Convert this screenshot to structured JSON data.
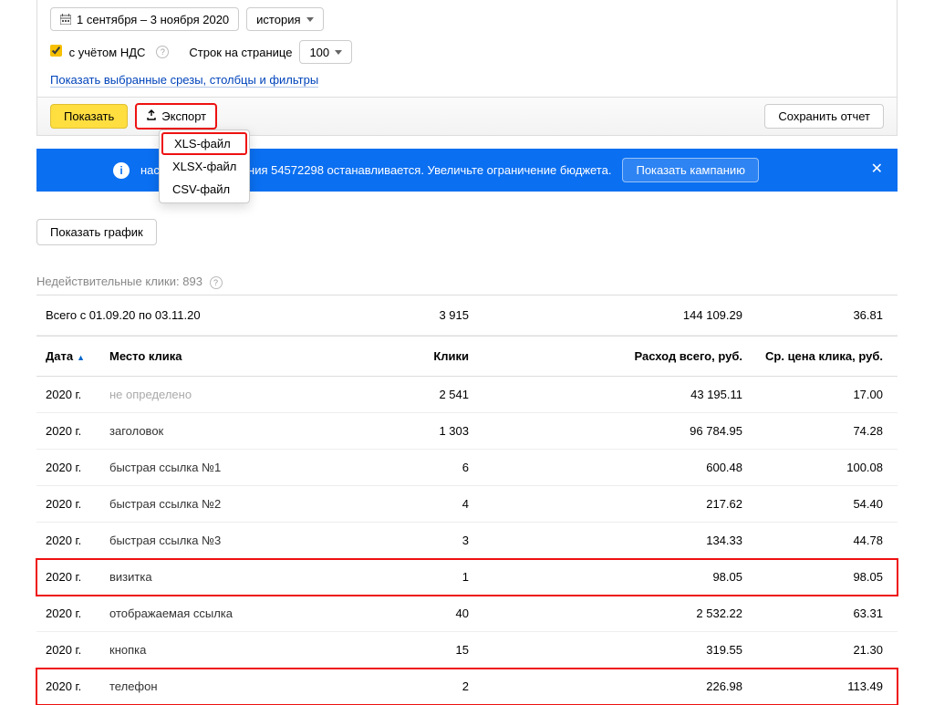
{
  "filters": {
    "date_range": "1 сентября – 3 ноября 2020",
    "history_label": "история",
    "nds_label": "с учётом НДС",
    "perpage_label": "Строк на странице",
    "perpage_value": "100",
    "filters_link": "Показать выбранные срезы, столбцы и фильтры"
  },
  "actions": {
    "show": "Показать",
    "export": "Экспорт",
    "save_report": "Сохранить отчет",
    "show_graph": "Показать график"
  },
  "export_menu": {
    "xls": "XLS-файл",
    "xlsx": "XLSX-файл",
    "csv": "CSV-файл"
  },
  "banner": {
    "text": "настройками кампания 54572298 останавливается. Увеличьте ограничение бюджета.",
    "action": "Показать кампанию"
  },
  "invalid_clicks": {
    "label": "Недействительные клики:",
    "value": "893"
  },
  "totals": {
    "label": "Всего с 01.09.20 по 03.11.20",
    "clicks": "3 915",
    "spend": "144 109.29",
    "cpc": "36.81"
  },
  "headers": {
    "date": "Дата",
    "click_location": "Место клика",
    "clicks": "Клики",
    "spend": "Расход всего, руб.",
    "cpc": "Ср. цена клика, руб."
  },
  "rows": [
    {
      "date": "2020 г.",
      "loc": "не определено",
      "muted": true,
      "clicks": "2 541",
      "spend": "43 195.11",
      "cpc": "17.00",
      "hl": false
    },
    {
      "date": "2020 г.",
      "loc": "заголовок",
      "muted": false,
      "clicks": "1 303",
      "spend": "96 784.95",
      "cpc": "74.28",
      "hl": false
    },
    {
      "date": "2020 г.",
      "loc": "быстрая ссылка №1",
      "muted": false,
      "clicks": "6",
      "spend": "600.48",
      "cpc": "100.08",
      "hl": false
    },
    {
      "date": "2020 г.",
      "loc": "быстрая ссылка №2",
      "muted": false,
      "clicks": "4",
      "spend": "217.62",
      "cpc": "54.40",
      "hl": false
    },
    {
      "date": "2020 г.",
      "loc": "быстрая ссылка №3",
      "muted": false,
      "clicks": "3",
      "spend": "134.33",
      "cpc": "44.78",
      "hl": false
    },
    {
      "date": "2020 г.",
      "loc": "визитка",
      "muted": false,
      "clicks": "1",
      "spend": "98.05",
      "cpc": "98.05",
      "hl": true
    },
    {
      "date": "2020 г.",
      "loc": "отображаемая ссылка",
      "muted": false,
      "clicks": "40",
      "spend": "2 532.22",
      "cpc": "63.31",
      "hl": false
    },
    {
      "date": "2020 г.",
      "loc": "кнопка",
      "muted": false,
      "clicks": "15",
      "spend": "319.55",
      "cpc": "21.30",
      "hl": false
    },
    {
      "date": "2020 г.",
      "loc": "телефон",
      "muted": false,
      "clicks": "2",
      "spend": "226.98",
      "cpc": "113.49",
      "hl": true
    }
  ]
}
